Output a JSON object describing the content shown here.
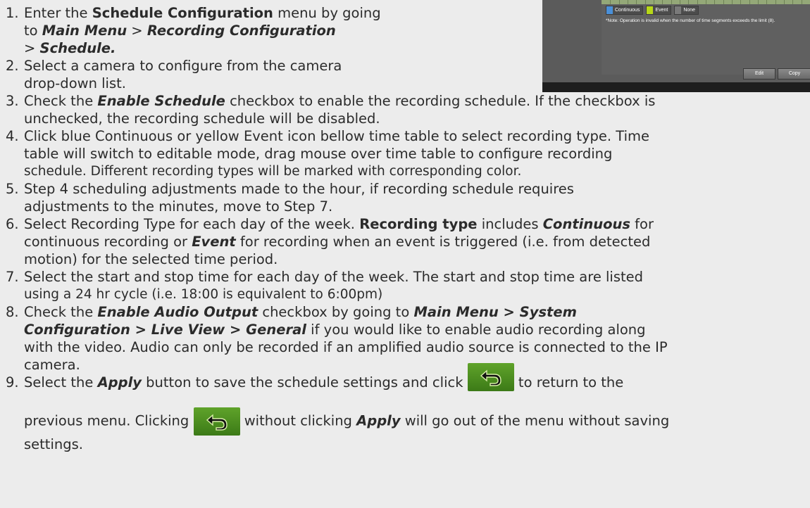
{
  "screenshot": {
    "legend": [
      "Continuous",
      "Event",
      "None"
    ],
    "legend_colors": {
      "continuous": "#4a90d9",
      "event": "#b8d818",
      "none": "#7a7a7a"
    },
    "note": "*Note: Operation is invalid when the number of time segments exceeds the limit (8).",
    "buttons": [
      "Edit",
      "Copy"
    ]
  },
  "steps": [
    {
      "n": "1.",
      "a": "Enter the ",
      "b": "Schedule Configuration",
      "c": " menu by going",
      "d": "to ",
      "e": "Main Menu",
      "f": " > ",
      "g": "Recording Configuration",
      "h": "> ",
      "i": "Schedule."
    },
    {
      "n": "2.",
      "l1": "Select a camera to configure from the camera",
      "l2": "drop-down list."
    },
    {
      "n": "3.",
      "a": "Check the ",
      "b": "Enable Schedule",
      "c": " checkbox to enable the recording schedule. If the checkbox is",
      "l2": "unchecked, the recording schedule will be disabled."
    },
    {
      "n": "4.",
      "l1": "Click blue Continuous or yellow Event icon bellow time table to select recording type. Time",
      "l2": "table will switch to editable mode, drag mouse over time table to configure recording",
      "l3": "schedule. Different recording types will be marked with corresponding color."
    },
    {
      "n": "5.",
      "l1": "Step 4 scheduling adjustments made to the hour, if recording schedule requires",
      "l2": "adjustments to the minutes, move to Step 7."
    },
    {
      "n": "6.",
      "a": "Select Recording Type for each day of the week. ",
      "b": "Recording type",
      "c": " includes ",
      "d": "Continuous",
      "e": " for",
      "f": "continuous recording or ",
      "g": "Event",
      "h": " for recording when an event is triggered (i.e. from detected",
      "l3": "motion) for the selected time period."
    },
    {
      "n": "7.",
      "l1": "Select the start and stop time for each day of the week. The start and stop time are listed",
      "l2": "using a 24 hr cycle (i.e. 18:00 is equivalent to 6:00pm)"
    },
    {
      "n": "8.",
      "a": "Check the ",
      "b": "Enable Audio Output",
      "c": " checkbox by going to ",
      "d": "Main Menu > System",
      "e": "Configuration > Live View > General",
      "f": " if you would like to enable audio recording along",
      "l3": "with the video. Audio can only be recorded if an amplified audio source is connected to the IP",
      "l4": "camera."
    },
    {
      "n": "9.",
      "a": "Select the ",
      "b": "Apply",
      "c": " button to save the schedule settings and click ",
      "d": " to return to the",
      "e": "previous menu. Clicking ",
      "f": " without clicking ",
      "g": "Apply",
      "h": " will go out of the menu without saving",
      "l3": "settings."
    }
  ]
}
